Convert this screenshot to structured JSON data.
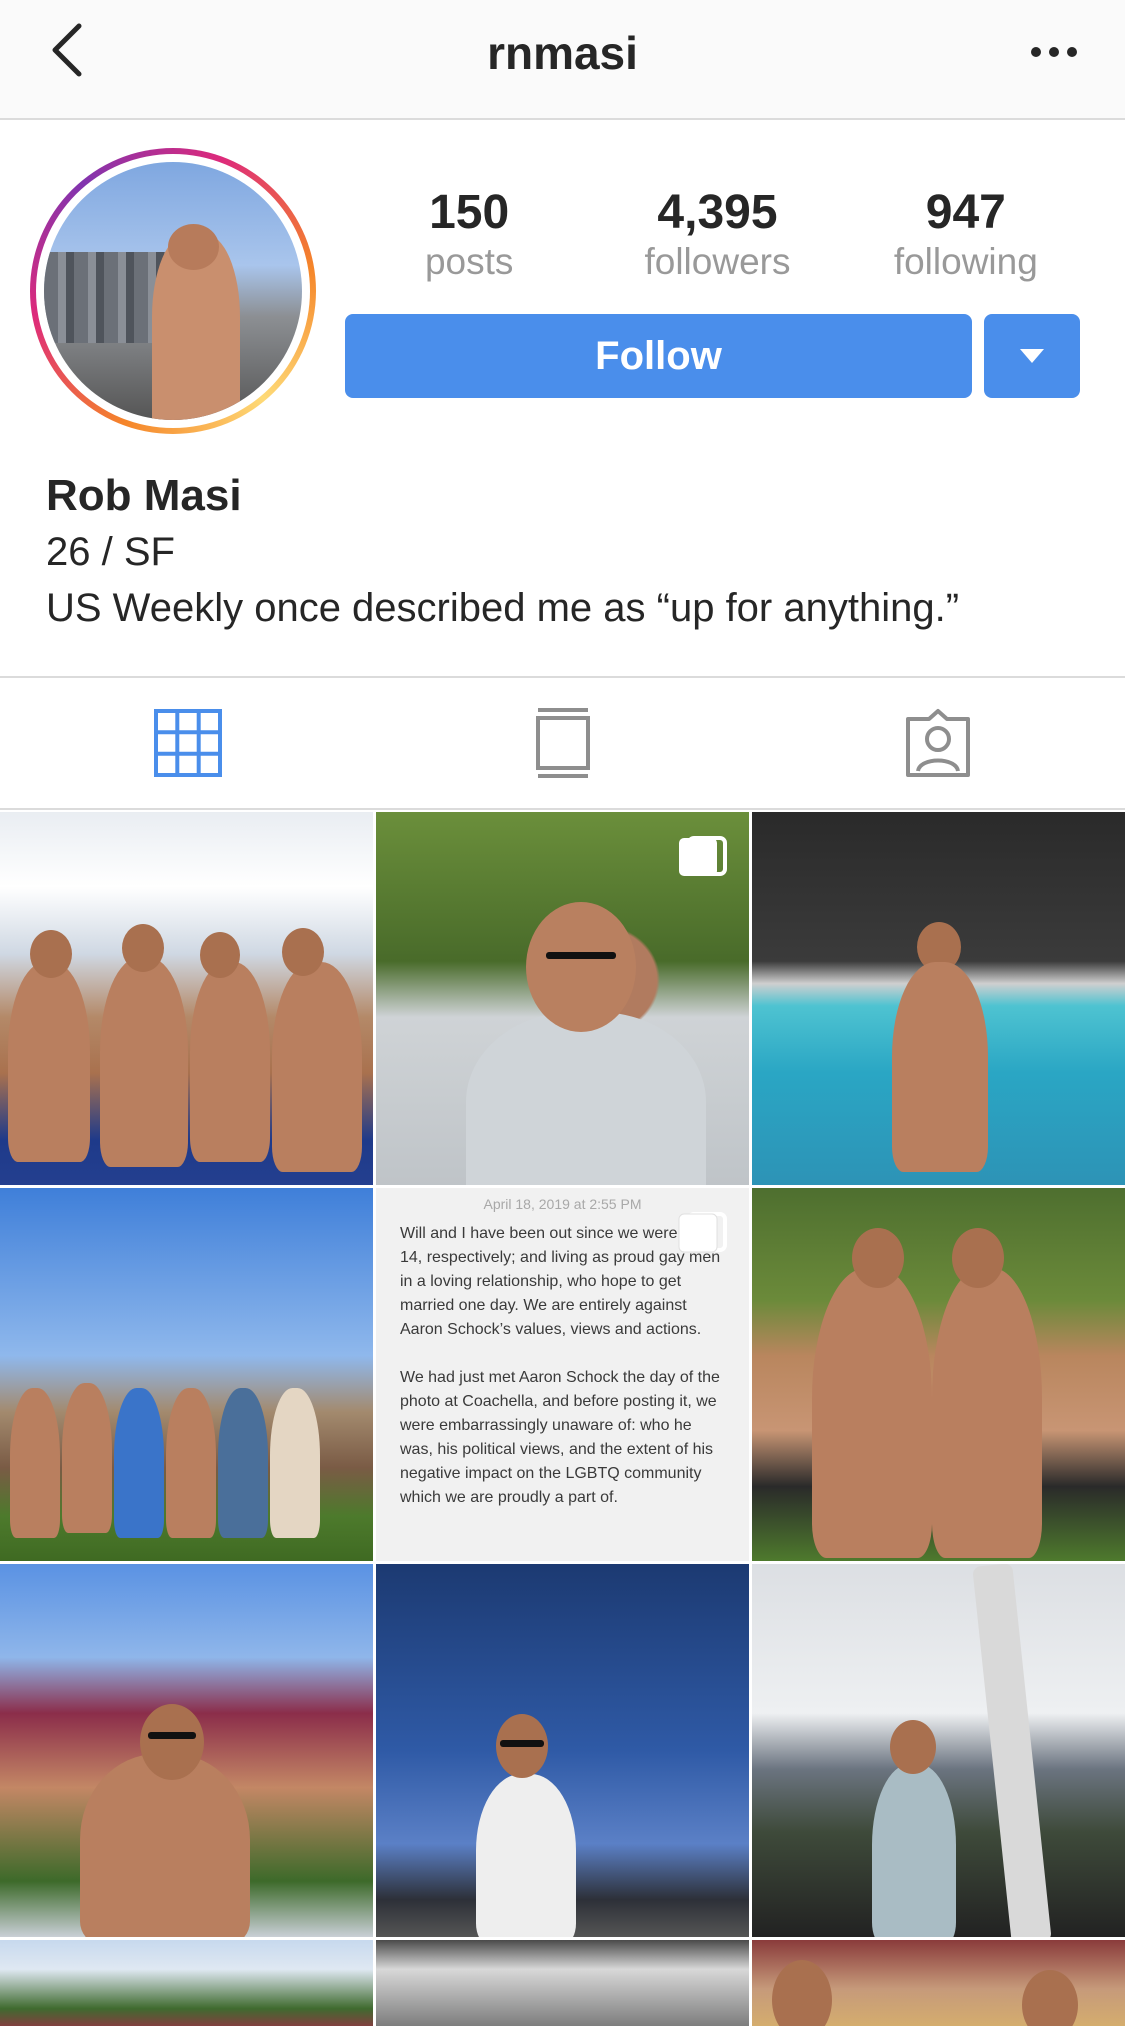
{
  "header": {
    "username": "rnmasi",
    "back_icon": "chevron-left-icon",
    "more_icon": "more-horizontal-icon"
  },
  "profile": {
    "stats": [
      {
        "value": "150",
        "label": "posts"
      },
      {
        "value": "4,395",
        "label": "followers"
      },
      {
        "value": "947",
        "label": "following"
      }
    ],
    "follow_label": "Follow",
    "name": "Rob Masi",
    "bio_lines": [
      "26 / SF",
      "US Weekly once described me as “up for anything.”"
    ]
  },
  "tabs": [
    {
      "name": "grid",
      "icon": "grid-icon",
      "active": true
    },
    {
      "name": "feed",
      "icon": "feed-icon",
      "active": false
    },
    {
      "name": "tagged",
      "icon": "tagged-user-icon",
      "active": false
    }
  ],
  "posts": {
    "note": {
      "date": "April 18, 2019 at 2:55 PM",
      "paragraphs": [
        "Will and I have been out since we were and 14, respectively; and living as proud gay men in a loving relationship, who hope to get married one day. We are entirely against Aaron Schock’s values, views and actions.",
        "We had just met Aaron Schock the day of the photo at Coachella, and before posting it, we were embarrassingly unaware of: who he was, his political views, and the extent of his negative impact on the LGBTQ community which we are proudly a part of."
      ]
    }
  },
  "colors": {
    "accent": "#4a8eeb",
    "text": "#262626",
    "muted": "#999999",
    "divider": "#dbdbdb"
  }
}
